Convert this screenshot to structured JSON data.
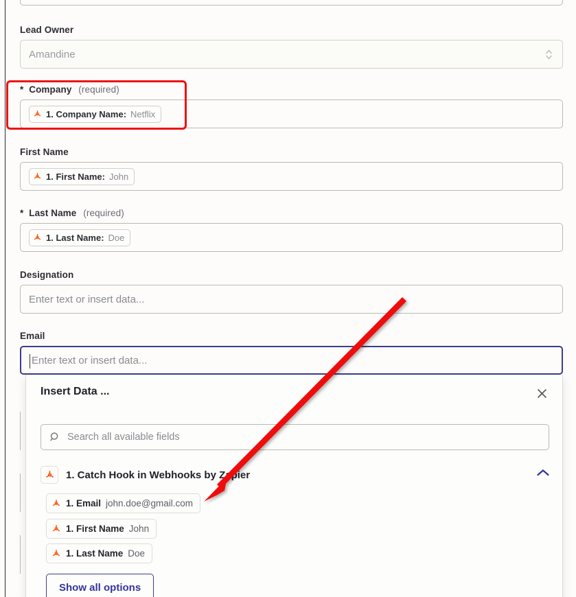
{
  "form": {
    "fields": [
      {
        "name": "lead-owner",
        "label": "Lead Owner",
        "required": false,
        "required_note": "",
        "type": "select",
        "value": "Amandine"
      },
      {
        "name": "company",
        "label": "Company",
        "required": true,
        "required_note": "(required)",
        "type": "token",
        "token_key": "1. Company Name:",
        "token_value": "Netflix",
        "highlighted": true
      },
      {
        "name": "first-name",
        "label": "First Name",
        "required": false,
        "required_note": "",
        "type": "token",
        "token_key": "1. First Name:",
        "token_value": "John"
      },
      {
        "name": "last-name",
        "label": "Last Name",
        "required": true,
        "required_note": "(required)",
        "type": "token",
        "token_key": "1. Last Name:",
        "token_value": "Doe"
      },
      {
        "name": "designation",
        "label": "Designation",
        "required": false,
        "required_note": "",
        "type": "text",
        "placeholder": "Enter text or insert data...",
        "value": ""
      },
      {
        "name": "email",
        "label": "Email",
        "required": false,
        "required_note": "",
        "type": "text",
        "placeholder": "Enter text or insert data...",
        "value": "",
        "focused": true
      }
    ],
    "required_star": "*"
  },
  "insert_data": {
    "title": "Insert Data ...",
    "close_icon": "close-icon",
    "search": {
      "placeholder": "Search all available fields",
      "value": "",
      "icon": "search-icon"
    },
    "group": {
      "icon": "zapier-icon",
      "label": "1. Catch Hook in Webhooks by Zapier",
      "collapse_icon": "chevron-up-icon",
      "expanded": true
    },
    "options": [
      {
        "icon": "zapier-icon",
        "key": "1. Email",
        "value": "john.doe@gmail.com"
      },
      {
        "icon": "zapier-icon",
        "key": "1. First Name",
        "value": "John"
      },
      {
        "icon": "zapier-icon",
        "key": "1. Last Name",
        "value": "Doe"
      }
    ],
    "show_all_label": "Show all options"
  },
  "annotations": {
    "highlight_box": {
      "target": "company-field",
      "color": "#ee1111"
    },
    "arrow": {
      "color": "#ee1111",
      "from": "email-field-area",
      "to": "option-email"
    }
  },
  "colors": {
    "accent": "#3c3c8c",
    "annotation": "#ee1111",
    "zapier_orange": "#ff4f00",
    "background": "#fdfcfa",
    "label_text": "#2c2c35",
    "placeholder_text": "#8a8a92"
  }
}
